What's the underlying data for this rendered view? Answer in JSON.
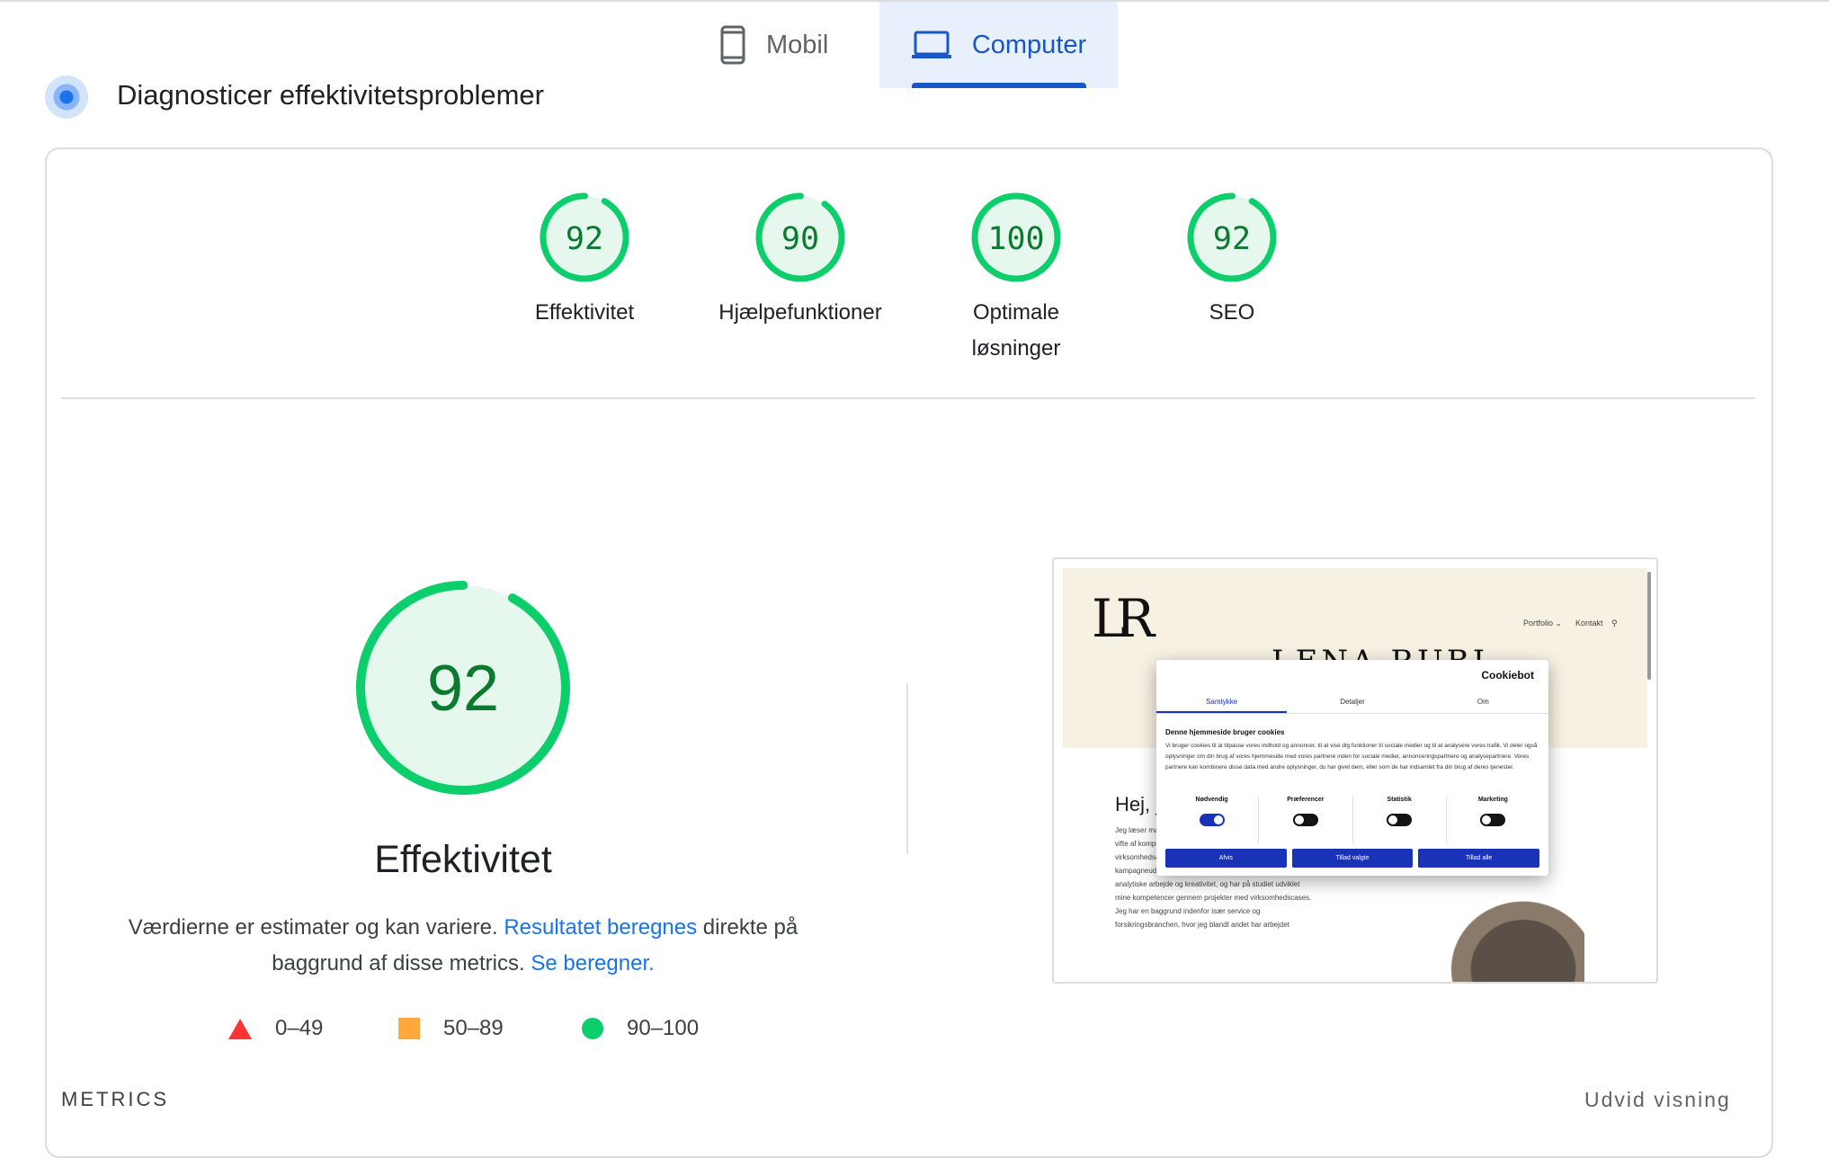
{
  "tabs": {
    "mobile": {
      "label": "Mobil",
      "icon": "smartphone-icon"
    },
    "computer": {
      "label": "Computer",
      "icon": "laptop-icon",
      "selected": true
    }
  },
  "section": {
    "title": "Diagnosticer effektivitetsproblemer"
  },
  "scores": [
    {
      "value": "92",
      "fraction": 0.92,
      "label": "Effektivitet"
    },
    {
      "value": "90",
      "fraction": 0.9,
      "label": "Hjælpefunktioner"
    },
    {
      "value": "100",
      "fraction": 1.0,
      "label": "Optimale løsninger"
    },
    {
      "value": "92",
      "fraction": 0.92,
      "label": "SEO"
    }
  ],
  "main_score": {
    "value": "92",
    "fraction": 0.92,
    "title": "Effektivitet",
    "desc_part1": "Værdierne er estimater og kan variere. ",
    "desc_link1": "Resultatet beregnes",
    "desc_part2": " direkte på baggrund af disse metrics. ",
    "desc_link2": "Se beregner."
  },
  "legend": [
    {
      "range": "0–49",
      "shape": "triangle",
      "color": "#ff3333"
    },
    {
      "range": "50–89",
      "shape": "square",
      "color": "#ffa83b"
    },
    {
      "range": "90–100",
      "shape": "circle",
      "color": "#0cce6b"
    }
  ],
  "colors": {
    "pass_ring": "#0cce6b",
    "pass_fill": "#e6f7ee",
    "pass_text": "#0a7a2f",
    "accent": "#1a56c4"
  },
  "thumbnail": {
    "logo": "LR",
    "nav_portfolio": "Portfolio ⌄",
    "nav_contact": "Kontakt",
    "hero_name": "LENA RUBI",
    "body_title": "Hej, je",
    "body_text": "Jeg læser ma Zealand Erhv som en digita Markedsføren bred vifte af kompetencer, herunder dybdegående virksomhedsanalyse, segmentering, koncept- og kampagneudvikling. Jeg trives i kombinationen af det analytiske arbejde og kreativitet, og har på studiet udviklet mine kompetencer gennem projekter med virksomhedscases. Jeg har en baggrund indenfor især service og forsikringsbranchen, hvor jeg blandt andet har arbejdet",
    "cookie": {
      "brand": "Cookiebot",
      "tabs": [
        "Samtykke",
        "Detaljer",
        "Om"
      ],
      "heading": "Denne hjemmeside bruger cookies",
      "text": "Vi bruger cookies til at tilpasse vores indhold og annoncer, til at vise dig funktioner til sociale medier og til at analysere vores trafik. Vi deler også oplysninger om din brug af vores hjemmeside med vores partnere inden for sociale medier, annonceringspartnere og analysepartnere. Vores partnere kan kombinere disse data med andre oplysninger, du har givet dem, eller som de har indsamlet fra din brug af deres tjenester.",
      "toggles": [
        {
          "label": "Nødvendig",
          "on": true
        },
        {
          "label": "Præferencer",
          "on": false
        },
        {
          "label": "Statistik",
          "on": false
        },
        {
          "label": "Marketing",
          "on": false
        }
      ],
      "buttons": [
        "Afvis",
        "Tillad valgte",
        "Tillad alle"
      ]
    }
  },
  "metrics": {
    "heading": "METRICS",
    "expand": "Udvid visning"
  }
}
